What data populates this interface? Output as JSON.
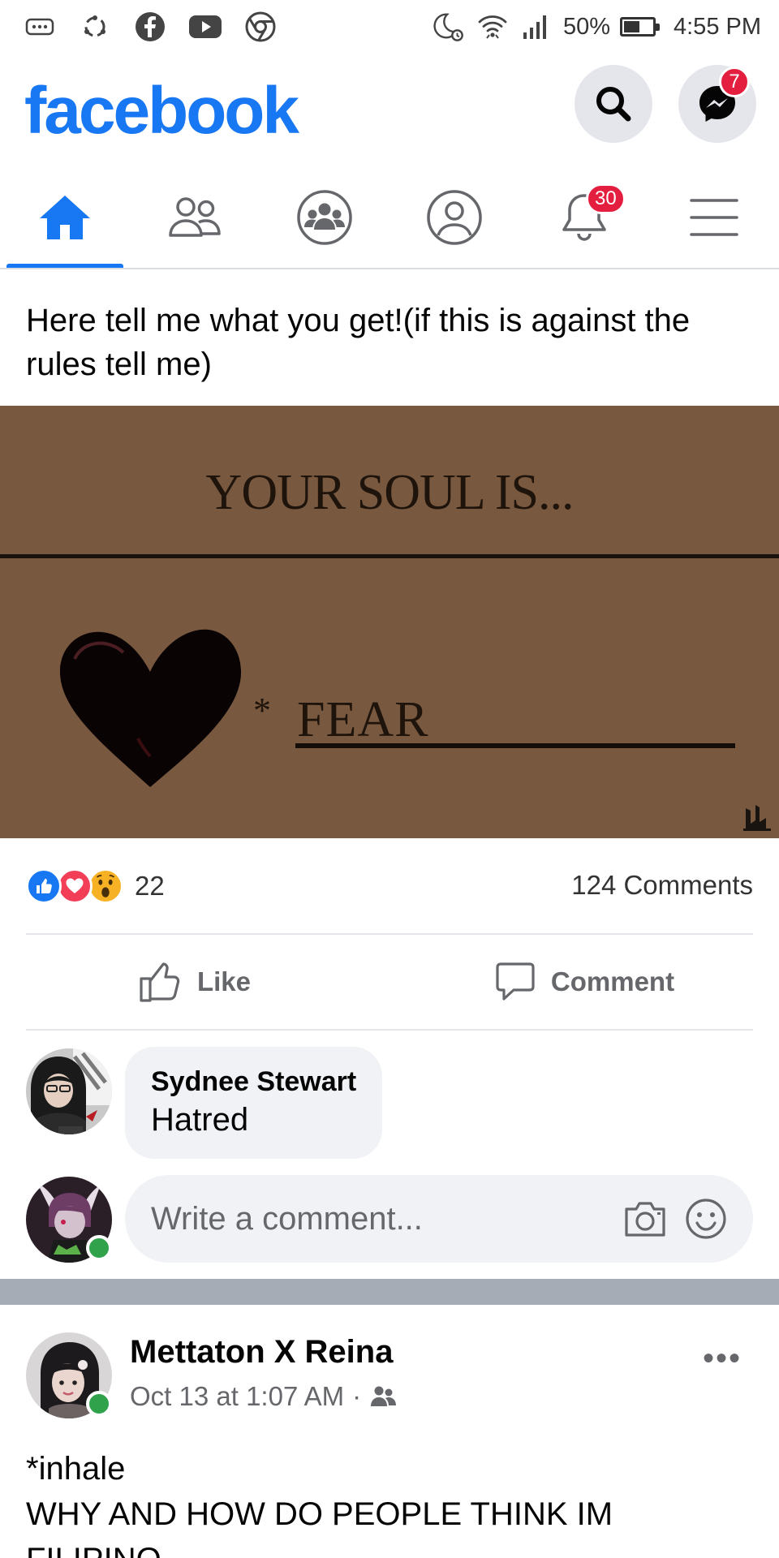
{
  "status_bar": {
    "battery": "50%",
    "battery_level": 0.5,
    "time": "4:55 PM"
  },
  "header": {
    "logo": "facebook",
    "messenger_badge": "7",
    "brand_color": "#1877f2"
  },
  "nav": {
    "tabs": [
      "home-icon",
      "friends-icon",
      "groups-icon",
      "profile-icon",
      "notifications-icon",
      "menu-icon"
    ],
    "active_tab": "home",
    "notifications_badge": "30"
  },
  "post": {
    "text": "Here tell me what you get!(if this is against the rules tell me)",
    "image": {
      "title": "YOUR SOUL IS...",
      "star": "*",
      "result": "FEAR"
    },
    "reactions": {
      "types": [
        "like",
        "love",
        "wow"
      ],
      "count": "22"
    },
    "comments_count": "124 Comments",
    "actions": {
      "like": "Like",
      "comment": "Comment"
    },
    "comment": {
      "author": "Sydnee Stewart",
      "text": "Hatred"
    },
    "write_comment_placeholder": "Write a comment..."
  },
  "post2": {
    "author": "Mettaton X Reina",
    "timestamp": "Oct 13 at 1:07 AM",
    "separator": "·",
    "audience_icon": "friends-icon",
    "more": "•••",
    "text_line1": "*inhale",
    "text_line2": "WHY AND HOW DO PEOPLE THINK IM",
    "text_line3": "FILIPINO"
  }
}
